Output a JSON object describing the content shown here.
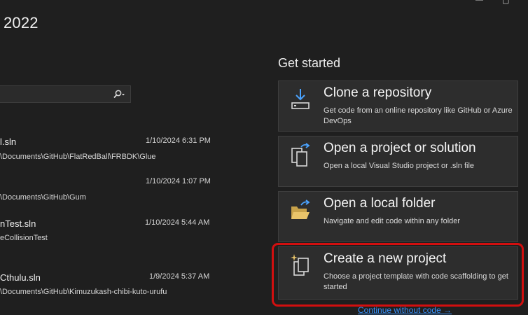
{
  "window": {
    "title": "2022",
    "minimize_glyph": "—",
    "maximize_glyph": "▢"
  },
  "search": {
    "icon": "search-icon"
  },
  "recent": [
    {
      "name": "l.sln",
      "path": "\\Documents\\GitHub\\FlatRedBall\\FRBDK\\Glue",
      "date": "1/10/2024 6:31 PM"
    },
    {
      "name": "",
      "path": "\\Documents\\GitHub\\Gum",
      "date": "1/10/2024 1:07 PM"
    },
    {
      "name": "nTest.sln",
      "path": "eCollisionTest",
      "date": "1/10/2024 5:44 AM"
    },
    {
      "name": "Cthulu.sln",
      "path": "\\Documents\\GitHub\\Kimuzukash-chibi-kuto-urufu",
      "date": "1/9/2024 5:37 AM"
    }
  ],
  "get_started": {
    "heading": "Get started",
    "cards": [
      {
        "icon": "clone-repository-icon",
        "title": "Clone a repository",
        "desc": "Get code from an online repository like GitHub or Azure DevOps"
      },
      {
        "icon": "open-project-icon",
        "title": "Open a project or solution",
        "desc": "Open a local Visual Studio project or .sln file"
      },
      {
        "icon": "open-folder-icon",
        "title": "Open a local folder",
        "desc": "Navigate and edit code within any folder"
      },
      {
        "icon": "new-project-icon",
        "title": "Create a new project",
        "desc": "Choose a project template with code scaffolding to get started"
      }
    ]
  },
  "continue_link": "Continue without code →",
  "colors": {
    "background": "#1f1f1f",
    "card": "#2d2d2d",
    "highlight": "#d20f0f",
    "link": "#3794ff"
  }
}
